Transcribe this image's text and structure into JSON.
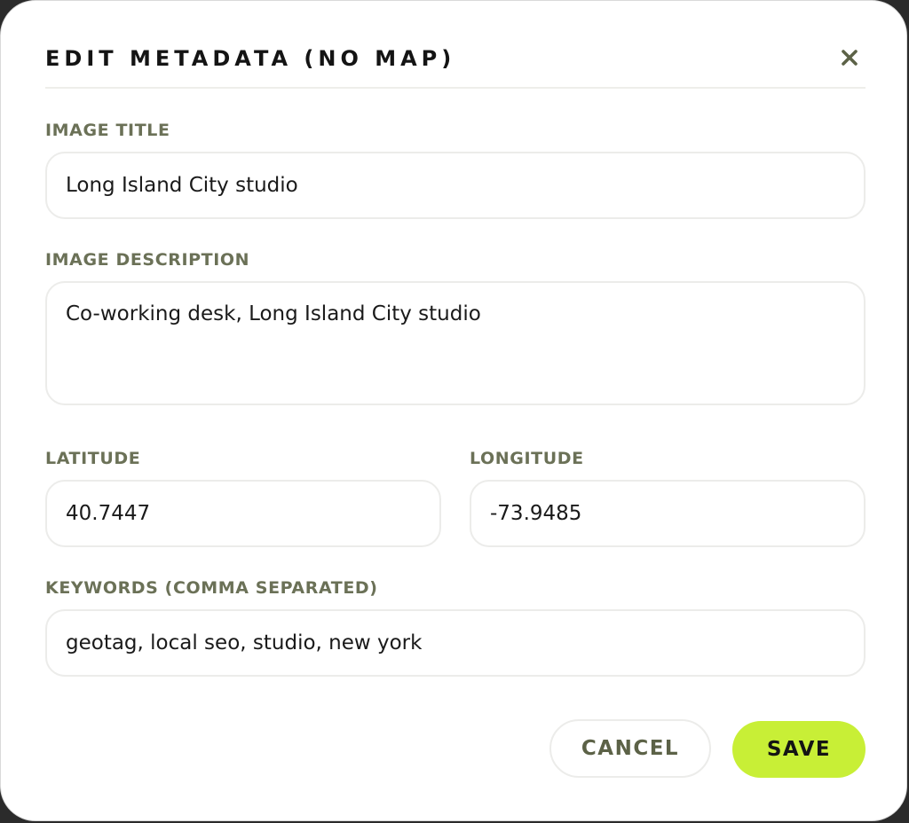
{
  "dialog": {
    "title": "EDIT METADATA (NO MAP)"
  },
  "fields": {
    "image_title": {
      "label": "IMAGE TITLE",
      "value": "Long Island City studio"
    },
    "image_description": {
      "label": "IMAGE DESCRIPTION",
      "value": "Co-working desk, Long Island City studio"
    },
    "latitude": {
      "label": "LATITUDE",
      "value": "40.7447"
    },
    "longitude": {
      "label": "LONGITUDE",
      "value": "-73.9485"
    },
    "keywords": {
      "label": "KEYWORDS (COMMA SEPARATED)",
      "value": "geotag, local seo, studio, new york"
    }
  },
  "actions": {
    "cancel_label": "CANCEL",
    "save_label": "SAVE"
  },
  "icons": {
    "close": "close-icon"
  },
  "colors": {
    "accent": "#c8ef36",
    "label": "#6b7157",
    "border": "#ececea"
  }
}
